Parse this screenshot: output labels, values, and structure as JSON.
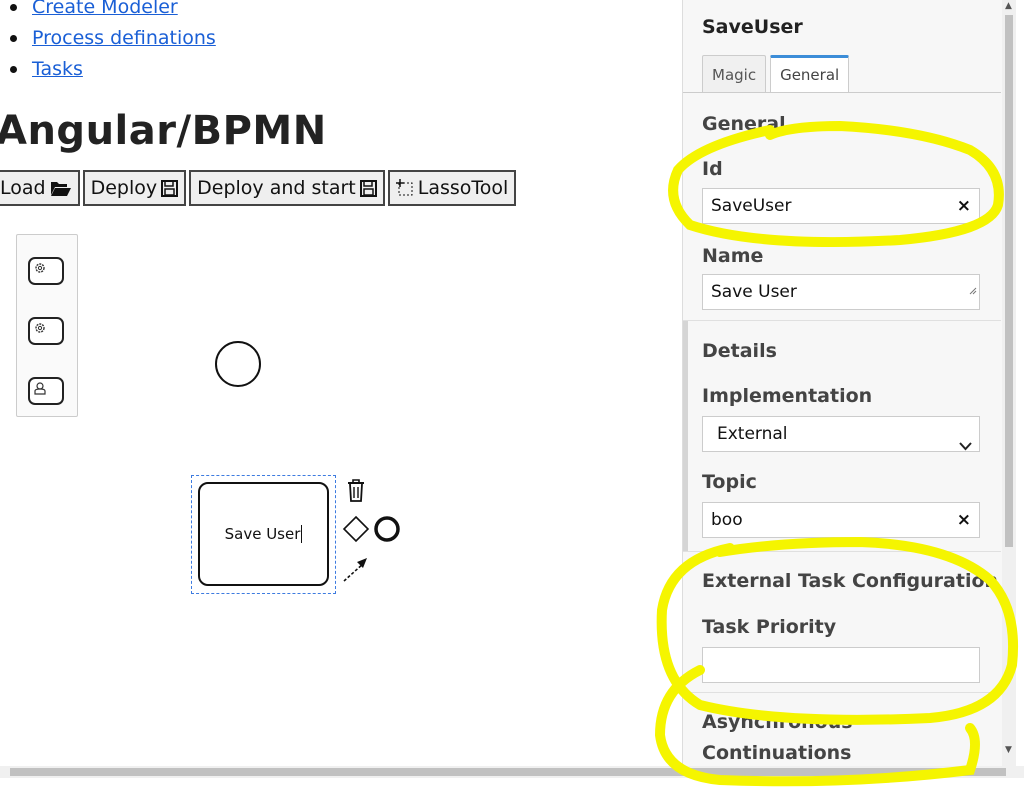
{
  "nav": {
    "links": [
      "Create Modeler",
      "Process definations",
      "Tasks"
    ]
  },
  "page_title": "Angular/BPMN",
  "toolbar": {
    "load_label": "Load",
    "deploy_label": "Deploy",
    "deploy_start_label": "Deploy and start",
    "lasso_label": "LassoTool"
  },
  "palette": {
    "items": [
      "service-task-icon",
      "service-task-icon",
      "user-task-icon"
    ]
  },
  "canvas": {
    "task_label": "Save User"
  },
  "panel": {
    "title": "SaveUser",
    "tabs": [
      "Magic",
      "General"
    ],
    "active_tab": "General",
    "general_group": "General",
    "id_label": "Id",
    "id_value": "SaveUser",
    "name_label": "Name",
    "name_value": "Save User",
    "details_group": "Details",
    "implementation_label": "Implementation",
    "implementation_value": "External",
    "topic_label": "Topic",
    "topic_value": "boo",
    "external_group": "External Task Configuration",
    "priority_label": "Task Priority",
    "priority_value": "",
    "async_group_line1": "Asynchronous",
    "async_group_line2": "Continuations",
    "clear_symbol": "×"
  },
  "colors": {
    "link": "#1a5fd6",
    "highlight": "#f5f500",
    "tab_accent": "#3c8dd8",
    "selection": "#3d7be0"
  }
}
